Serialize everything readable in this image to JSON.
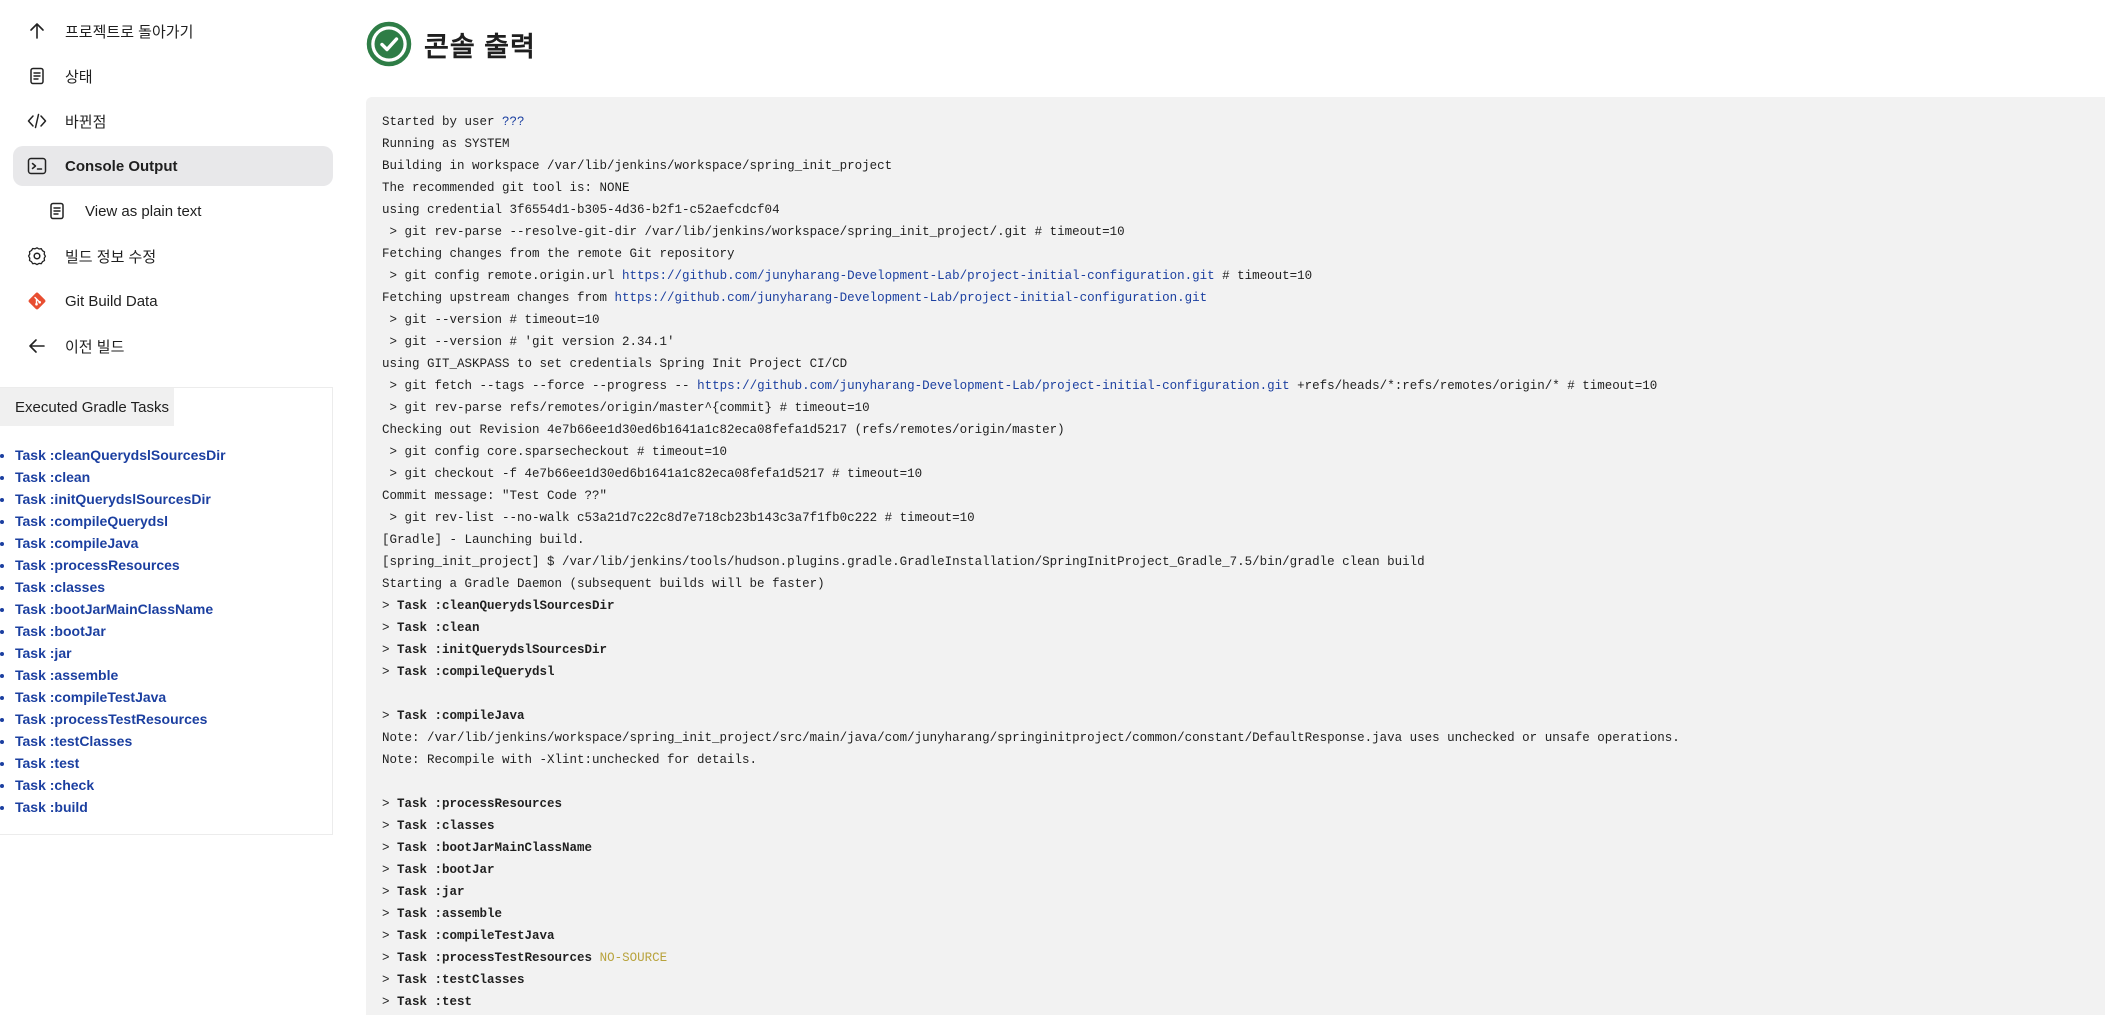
{
  "sidebar": {
    "items": [
      {
        "label": "프로젝트로 돌아가기",
        "icon": "arrow-up-icon",
        "name": "nav-back-to-project"
      },
      {
        "label": "상태",
        "icon": "document-icon",
        "name": "nav-status"
      },
      {
        "label": "바뀐점",
        "icon": "code-icon",
        "name": "nav-changes"
      },
      {
        "label": "Console Output",
        "icon": "terminal-icon",
        "name": "nav-console-output",
        "active": true
      },
      {
        "label": "View as plain text",
        "icon": "document-icon",
        "name": "nav-view-plain-text",
        "sub": true
      },
      {
        "label": "빌드 정보 수정",
        "icon": "gear-icon",
        "name": "nav-edit-build-info"
      },
      {
        "label": "Git Build Data",
        "icon": "git-icon",
        "name": "nav-git-build-data"
      },
      {
        "label": "이전 빌드",
        "icon": "arrow-left-icon",
        "name": "nav-previous-build"
      }
    ],
    "gradle_tab": "Executed Gradle Tasks",
    "tasks": [
      "Task :cleanQuerydslSourcesDir",
      "Task :clean",
      "Task :initQuerydslSourcesDir",
      "Task :compileQuerydsl",
      "Task :compileJava",
      "Task :processResources",
      "Task :classes",
      "Task :bootJarMainClassName",
      "Task :bootJar",
      "Task :jar",
      "Task :assemble",
      "Task :compileTestJava",
      "Task :processTestResources",
      "Task :testClasses",
      "Task :test",
      "Task :check",
      "Task :build"
    ]
  },
  "header": {
    "title": "콘솔 출력",
    "status_icon": "success-check-icon",
    "status_color": "#2e7d46"
  },
  "console": {
    "lines": [
      [
        {
          "t": "Started by user "
        },
        {
          "t": "???",
          "k": "link"
        }
      ],
      [
        {
          "t": "Running as SYSTEM"
        }
      ],
      [
        {
          "t": "Building in workspace /var/lib/jenkins/workspace/spring_init_project"
        }
      ],
      [
        {
          "t": "The recommended git tool is: NONE"
        }
      ],
      [
        {
          "t": "using credential 3f6554d1-b305-4d36-b2f1-c52aefcdcf04"
        }
      ],
      [
        {
          "t": " > git rev-parse --resolve-git-dir /var/lib/jenkins/workspace/spring_init_project/.git # timeout=10"
        }
      ],
      [
        {
          "t": "Fetching changes from the remote Git repository"
        }
      ],
      [
        {
          "t": " > git config remote.origin.url "
        },
        {
          "t": "https://github.com/junyharang-Development-Lab/project-initial-configuration.git",
          "k": "link"
        },
        {
          "t": " # timeout=10"
        }
      ],
      [
        {
          "t": "Fetching upstream changes from "
        },
        {
          "t": "https://github.com/junyharang-Development-Lab/project-initial-configuration.git",
          "k": "link"
        }
      ],
      [
        {
          "t": " > git --version # timeout=10"
        }
      ],
      [
        {
          "t": " > git --version # 'git version 2.34.1'"
        }
      ],
      [
        {
          "t": "using GIT_ASKPASS to set credentials Spring Init Project CI/CD"
        }
      ],
      [
        {
          "t": " > git fetch --tags --force --progress -- "
        },
        {
          "t": "https://github.com/junyharang-Development-Lab/project-initial-configuration.git",
          "k": "link"
        },
        {
          "t": " +refs/heads/*:refs/remotes/origin/* # timeout=10"
        }
      ],
      [
        {
          "t": " > git rev-parse refs/remotes/origin/master^{commit} # timeout=10"
        }
      ],
      [
        {
          "t": "Checking out Revision 4e7b66ee1d30ed6b1641a1c82eca08fefa1d5217 (refs/remotes/origin/master)"
        }
      ],
      [
        {
          "t": " > git config core.sparsecheckout # timeout=10"
        }
      ],
      [
        {
          "t": " > git checkout -f 4e7b66ee1d30ed6b1641a1c82eca08fefa1d5217 # timeout=10"
        }
      ],
      [
        {
          "t": "Commit message: \"Test Code ??\""
        }
      ],
      [
        {
          "t": " > git rev-list --no-walk c53a21d7c22c8d7e718cb23b143c3a7f1fb0c222 # timeout=10"
        }
      ],
      [
        {
          "t": "[Gradle] - Launching build."
        }
      ],
      [
        {
          "t": "[spring_init_project] $ /var/lib/jenkins/tools/hudson.plugins.gradle.GradleInstallation/SpringInitProject_Gradle_7.5/bin/gradle clean build"
        }
      ],
      [
        {
          "t": "Starting a Gradle Daemon (subsequent builds will be faster)"
        }
      ],
      [
        {
          "t": "> "
        },
        {
          "t": "Task :cleanQuerydslSourcesDir",
          "k": "bold"
        }
      ],
      [
        {
          "t": "> "
        },
        {
          "t": "Task :clean",
          "k": "bold"
        }
      ],
      [
        {
          "t": "> "
        },
        {
          "t": "Task :initQuerydslSourcesDir",
          "k": "bold"
        }
      ],
      [
        {
          "t": "> "
        },
        {
          "t": "Task :compileQuerydsl",
          "k": "bold"
        }
      ],
      [
        {
          "t": ""
        }
      ],
      [
        {
          "t": "> "
        },
        {
          "t": "Task :compileJava",
          "k": "bold"
        }
      ],
      [
        {
          "t": "Note: /var/lib/jenkins/workspace/spring_init_project/src/main/java/com/junyharang/springinitproject/common/constant/DefaultResponse.java uses unchecked or unsafe operations."
        }
      ],
      [
        {
          "t": "Note: Recompile with -Xlint:unchecked for details."
        }
      ],
      [
        {
          "t": ""
        }
      ],
      [
        {
          "t": "> "
        },
        {
          "t": "Task :processResources",
          "k": "bold"
        }
      ],
      [
        {
          "t": "> "
        },
        {
          "t": "Task :classes",
          "k": "bold"
        }
      ],
      [
        {
          "t": "> "
        },
        {
          "t": "Task :bootJarMainClassName",
          "k": "bold"
        }
      ],
      [
        {
          "t": "> "
        },
        {
          "t": "Task :bootJar",
          "k": "bold"
        }
      ],
      [
        {
          "t": "> "
        },
        {
          "t": "Task :jar",
          "k": "bold"
        }
      ],
      [
        {
          "t": "> "
        },
        {
          "t": "Task :assemble",
          "k": "bold"
        }
      ],
      [
        {
          "t": "> "
        },
        {
          "t": "Task :compileTestJava",
          "k": "bold"
        }
      ],
      [
        {
          "t": "> "
        },
        {
          "t": "Task :processTestResources",
          "k": "bold"
        },
        {
          "t": " "
        },
        {
          "t": "NO-SOURCE",
          "k": "nosource"
        }
      ],
      [
        {
          "t": "> "
        },
        {
          "t": "Task :testClasses",
          "k": "bold"
        }
      ],
      [
        {
          "t": "> "
        },
        {
          "t": "Task :test",
          "k": "bold"
        }
      ]
    ]
  }
}
